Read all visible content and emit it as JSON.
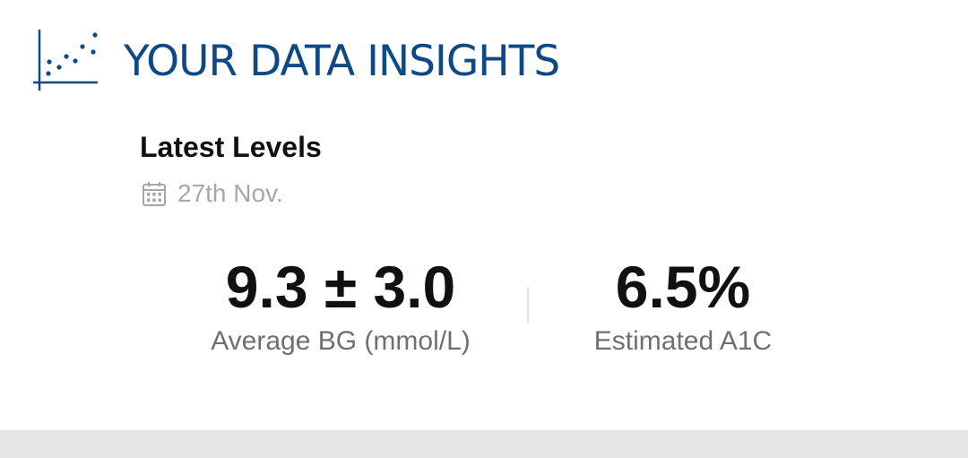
{
  "header": {
    "icon": "scatter-plot-icon",
    "title": "YOUR DATA INSIGHTS",
    "accent_color": "#0d4a85"
  },
  "card": {
    "title": "Latest Levels",
    "date_icon": "calendar-icon",
    "date": "27th Nov."
  },
  "metrics": {
    "average_bg": {
      "value": "9.3 ± 3.0",
      "label": "Average BG (mmol/L)"
    },
    "estimated_a1c": {
      "value": "6.5%",
      "label": "Estimated A1C"
    }
  }
}
